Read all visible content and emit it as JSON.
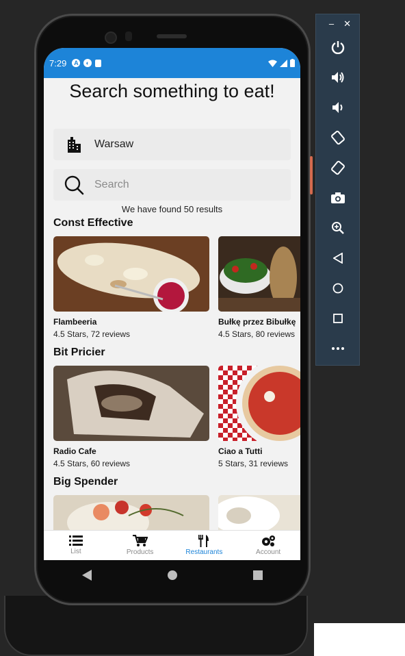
{
  "status": {
    "time": "7:29"
  },
  "app": {
    "title": "Search something to eat!",
    "city": {
      "value": "Warsaw"
    },
    "search": {
      "placeholder": "Search"
    },
    "results_text": "We have found 50 results",
    "sections": [
      {
        "title": "Const Effective",
        "cards": [
          {
            "name": "Flambeeria",
            "meta": "4.5 Stars, 72 reviews"
          },
          {
            "name": "Bułkę przez Bibułkę",
            "meta": "4.5 Stars, 80 reviews"
          }
        ]
      },
      {
        "title": "Bit Pricier",
        "cards": [
          {
            "name": "Radio Cafe",
            "meta": "4.5 Stars, 60 reviews"
          },
          {
            "name": "Ciao a Tutti",
            "meta": "5 Stars, 31 reviews"
          }
        ]
      },
      {
        "title": "Big Spender",
        "cards": [
          {
            "name": "",
            "meta": ""
          },
          {
            "name": "",
            "meta": ""
          }
        ]
      }
    ],
    "nav": [
      {
        "label": "List",
        "icon": "list-icon"
      },
      {
        "label": "Products",
        "icon": "cart-icon"
      },
      {
        "label": "Restaurants",
        "icon": "fork-knife-icon",
        "active": true
      },
      {
        "label": "Account",
        "icon": "gears-icon"
      }
    ]
  },
  "emulator": {
    "buttons": [
      "power-icon",
      "volume-up-icon",
      "volume-down-icon",
      "rotate-left-icon",
      "rotate-right-icon",
      "camera-icon",
      "zoom-icon",
      "back-icon",
      "home-icon",
      "overview-icon",
      "more-icon"
    ]
  },
  "colors": {
    "accent": "#1d84d8",
    "panel": "#2a3b4b"
  }
}
